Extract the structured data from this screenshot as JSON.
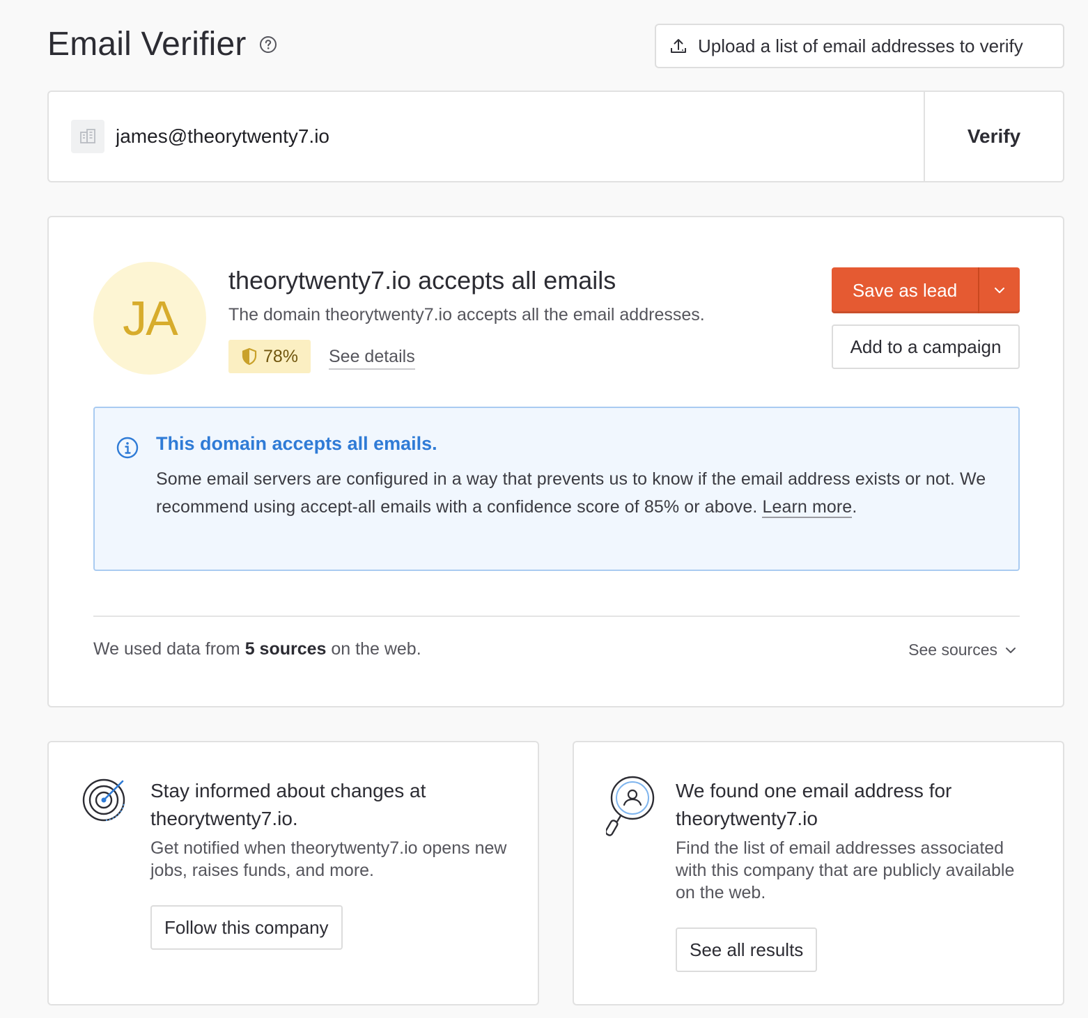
{
  "header": {
    "title": "Email Verifier",
    "upload_label": "Upload a list of email addresses to verify"
  },
  "search": {
    "value": "james@theorytwenty7.io",
    "verify_label": "Verify"
  },
  "result": {
    "avatar_initials": "JA",
    "title": "theorytwenty7.io accepts all emails",
    "subtitle": "The domain theorytwenty7.io accepts all the email addresses.",
    "score": "78%",
    "see_details": "See details",
    "save_label": "Save as lead",
    "campaign_label": "Add to a campaign",
    "info": {
      "title": "This domain accepts all emails.",
      "text": "Some email servers are configured in a way that prevents us to know if the email address exists or not. We recommend using accept-all emails with a confidence score of 85% or above. ",
      "learn_more": "Learn more",
      "period": "."
    },
    "sources": {
      "prefix": "We used data from ",
      "count_text": "5 sources",
      "suffix": " on the web.",
      "toggle_label": "See sources"
    }
  },
  "follow_card": {
    "title": "Stay informed about changes at theorytwenty7.io.",
    "text": "Get notified when theorytwenty7.io opens new jobs, raises funds, and more.",
    "button": "Follow this company"
  },
  "results_card": {
    "title": "We found one email address for theorytwenty7.io",
    "text": "Find the list of email addresses associated with this company that are publicly available on the web.",
    "button": "See all results"
  },
  "colors": {
    "accent": "#e55a32",
    "info_blue": "#2f7bd6",
    "avatar_bg": "#fdf5d3",
    "score_bg": "#fbefc2"
  }
}
